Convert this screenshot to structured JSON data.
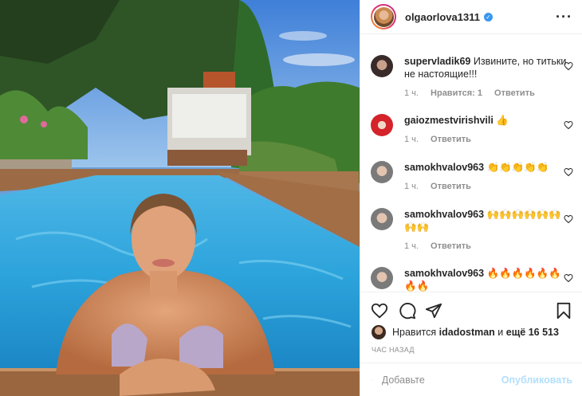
{
  "post": {
    "author": "olgaorlova1311",
    "verified_mark": "✓",
    "more_icon": "more-icon"
  },
  "comments": [
    {
      "user": "supervladik69",
      "text": "Извините, но титьки не настоящие!!!",
      "time": "1 ч.",
      "likes": "Нравится: 1",
      "reply": "Ответить"
    },
    {
      "user": "gaiozmestvirishvili",
      "text": "👍",
      "time": "1 ч.",
      "reply": "Ответить"
    },
    {
      "user": "samokhvalov963",
      "text": "👏👏👏👏👏",
      "time": "1 ч.",
      "reply": "Ответить"
    },
    {
      "user": "samokhvalov963",
      "text": "🙌🙌🙌🙌🙌🙌🙌🙌",
      "time": "1 ч.",
      "reply": "Ответить"
    },
    {
      "user": "samokhvalov963",
      "text": "🔥🔥🔥🔥🔥🔥🔥🔥",
      "time": "",
      "reply": ""
    }
  ],
  "likes": {
    "prefix": "Нравится",
    "user": "idadostman",
    "middle": "и",
    "count": "ещё 16 513"
  },
  "time_ago": "ЧАС НАЗАД",
  "add_comment": {
    "placeholder": "Добавьте",
    "publish": "Опубликовать"
  },
  "colors": {
    "accent": "#3897f0",
    "publish_disabled": "#b2dffc",
    "meta": "#8e8e8e"
  }
}
